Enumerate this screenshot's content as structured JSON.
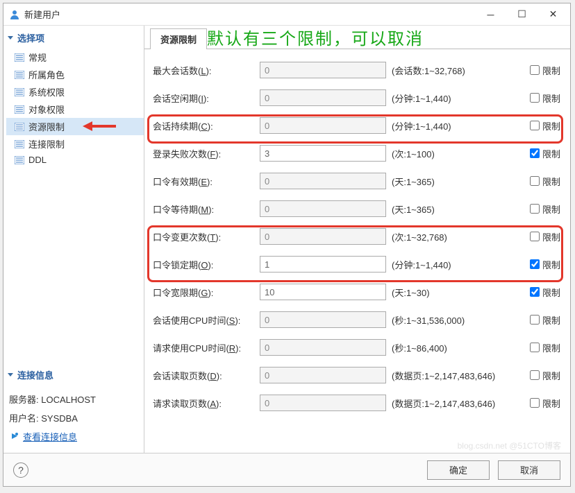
{
  "window": {
    "title": "新建用户"
  },
  "annotation": "默认有三个限制，可以取消",
  "sidebar": {
    "select_header": "选择项",
    "items": [
      {
        "label": "常规"
      },
      {
        "label": "所属角色"
      },
      {
        "label": "系统权限"
      },
      {
        "label": "对象权限"
      },
      {
        "label": "资源限制",
        "selected": true,
        "pointed": true
      },
      {
        "label": "连接限制"
      },
      {
        "label": "DDL"
      }
    ],
    "conn_header": "连接信息",
    "server_label": "服务器: LOCALHOST",
    "user_label": "用户名: SYSDBA",
    "view_link": "查看连接信息"
  },
  "tab": {
    "label": "资源限制"
  },
  "rows": [
    {
      "label_pre": "最大会话数(",
      "key": "L",
      "label_post": "):",
      "value": "0",
      "hint": "(会话数:1~32,768)",
      "checked": false,
      "enabled": false
    },
    {
      "label_pre": "会话空闲期(",
      "key": "I",
      "label_post": "):",
      "value": "0",
      "hint": "(分钟:1~1,440)",
      "checked": false,
      "enabled": false
    },
    {
      "label_pre": "会话持续期(",
      "key": "C",
      "label_post": "):",
      "value": "0",
      "hint": "(分钟:1~1,440)",
      "checked": false,
      "enabled": false
    },
    {
      "label_pre": "登录失败次数(",
      "key": "F",
      "label_post": "):",
      "value": "3",
      "hint": "(次:1~100)",
      "checked": true,
      "enabled": true
    },
    {
      "label_pre": "口令有效期(",
      "key": "E",
      "label_post": "):",
      "value": "0",
      "hint": "(天:1~365)",
      "checked": false,
      "enabled": false
    },
    {
      "label_pre": "口令等待期(",
      "key": "M",
      "label_post": "):",
      "value": "0",
      "hint": "(天:1~365)",
      "checked": false,
      "enabled": false
    },
    {
      "label_pre": "口令变更次数(",
      "key": "T",
      "label_post": "):",
      "value": "0",
      "hint": "(次:1~32,768)",
      "checked": false,
      "enabled": false
    },
    {
      "label_pre": "口令锁定期(",
      "key": "O",
      "label_post": "):",
      "value": "1",
      "hint": "(分钟:1~1,440)",
      "checked": true,
      "enabled": true
    },
    {
      "label_pre": "口令宽限期(",
      "key": "G",
      "label_post": "):",
      "value": "10",
      "hint": "(天:1~30)",
      "checked": true,
      "enabled": true
    },
    {
      "label_pre": "会话使用CPU时间(",
      "key": "S",
      "label_post": "):",
      "value": "0",
      "hint": "(秒:1~31,536,000)",
      "checked": false,
      "enabled": false
    },
    {
      "label_pre": "请求使用CPU时间(",
      "key": "R",
      "label_post": "):",
      "value": "0",
      "hint": "(秒:1~86,400)",
      "checked": false,
      "enabled": false
    },
    {
      "label_pre": "会话读取页数(",
      "key": "D",
      "label_post": "):",
      "value": "0",
      "hint": "(数据页:1~2,147,483,646)",
      "checked": false,
      "enabled": false
    },
    {
      "label_pre": "请求读取页数(",
      "key": "A",
      "label_post": "):",
      "value": "0",
      "hint": "(数据页:1~2,147,483,646)",
      "checked": false,
      "enabled": false
    }
  ],
  "chk_label": "限制",
  "footer": {
    "ok": "确定",
    "cancel": "取消"
  },
  "watermark": "blog.csdn.net @51CTO博客"
}
